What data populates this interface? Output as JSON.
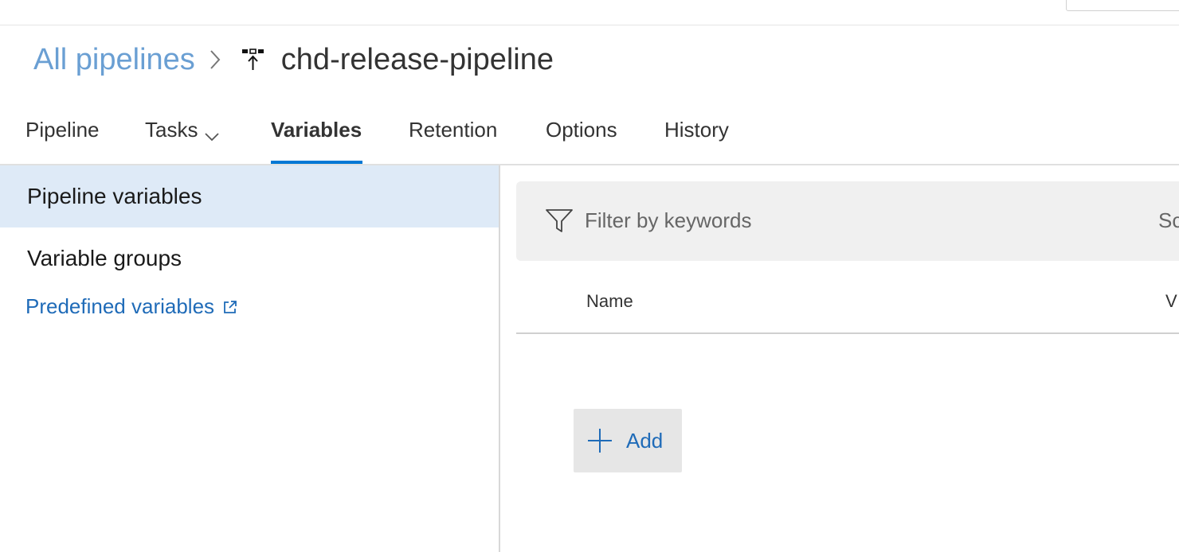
{
  "colors": {
    "accent": "#0078d4",
    "link": "#1f6bb8",
    "breadcrumb_link": "#6a9fd3",
    "selected_bg": "#deeaf7"
  },
  "breadcrumb": {
    "root_label": "All pipelines",
    "separator_icon": "chevron-right-icon",
    "pipeline_icon": "release-pipeline-icon",
    "title": "chd-release-pipeline"
  },
  "tabs": [
    {
      "label": "Pipeline",
      "active": false
    },
    {
      "label": "Tasks",
      "active": false,
      "has_dropdown": true
    },
    {
      "label": "Variables",
      "active": true
    },
    {
      "label": "Retention",
      "active": false
    },
    {
      "label": "Options",
      "active": false
    },
    {
      "label": "History",
      "active": false
    }
  ],
  "sidebar": {
    "items": [
      {
        "label": "Pipeline variables",
        "selected": true
      },
      {
        "label": "Variable groups",
        "selected": false
      }
    ],
    "link": {
      "label": "Predefined variables",
      "icon": "external-link-icon"
    }
  },
  "filter": {
    "placeholder": "Filter by keywords",
    "icon": "filter-icon",
    "scope_label": "Sc"
  },
  "table": {
    "columns": [
      "Name",
      "V"
    ]
  },
  "add_button": {
    "label": "Add",
    "icon": "plus-icon"
  }
}
